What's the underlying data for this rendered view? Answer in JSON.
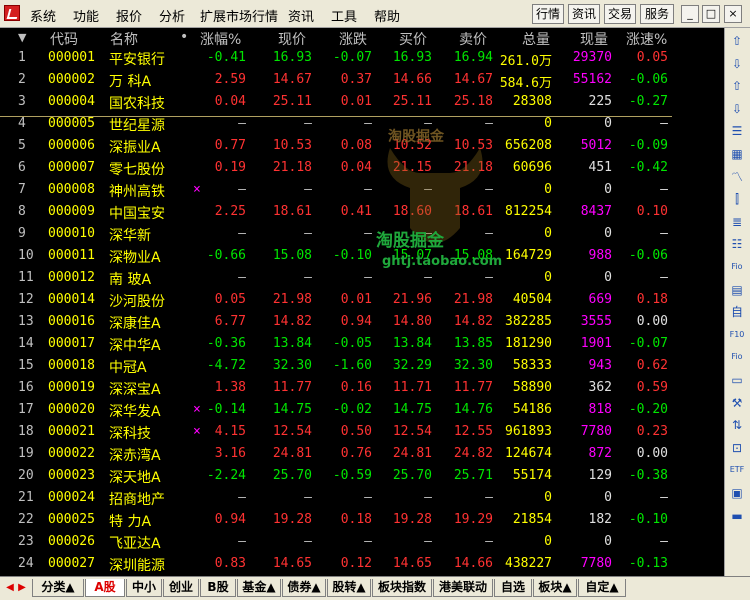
{
  "menubar": {
    "items": [
      "系统",
      "功能",
      "报价",
      "分析",
      "扩展市场行情",
      "资讯",
      "工具",
      "帮助"
    ],
    "right_buttons": [
      "行情",
      "资讯",
      "交易",
      "服务"
    ],
    "window_buttons": [
      "_",
      "□",
      "×"
    ]
  },
  "table": {
    "headers": {
      "sort": "▼",
      "code": "代码",
      "name": "名称",
      "dot": "•",
      "pct": "涨幅%",
      "price": "现价",
      "change": "涨跌",
      "bid": "买价",
      "ask": "卖价",
      "vol": "总量",
      "cur": "现量",
      "speed": "涨速%"
    },
    "rows": [
      {
        "n": "1",
        "code": "000001",
        "name": "平安银行",
        "mark": "",
        "pct": "-0.41",
        "price": "16.93",
        "chg": "-0.07",
        "bid": "16.93",
        "ask": "16.94",
        "vol": "261.0万",
        "cur": "29370",
        "spd": "0.05",
        "dir": "down",
        "curc": "m",
        "spdc": "r"
      },
      {
        "n": "2",
        "code": "000002",
        "name": "万 科A",
        "mark": "",
        "pct": "2.59",
        "price": "14.67",
        "chg": "0.37",
        "bid": "14.66",
        "ask": "14.67",
        "vol": "584.6万",
        "cur": "55162",
        "spd": "-0.06",
        "dir": "up",
        "curc": "m",
        "spdc": "g"
      },
      {
        "n": "3",
        "code": "000004",
        "name": "国农科技",
        "mark": "",
        "pct": "0.04",
        "price": "25.11",
        "chg": "0.01",
        "bid": "25.11",
        "ask": "25.18",
        "vol": "28308",
        "cur": "225",
        "spd": "-0.27",
        "dir": "up",
        "curc": "w",
        "spdc": "g"
      },
      {
        "n": "4",
        "code": "000005",
        "name": "世纪星源",
        "mark": "",
        "pct": "–",
        "price": "–",
        "chg": "–",
        "bid": "–",
        "ask": "–",
        "vol": "0",
        "cur": "0",
        "spd": "–",
        "dir": "flat",
        "curc": "w",
        "spdc": "w"
      },
      {
        "n": "5",
        "code": "000006",
        "name": "深振业A",
        "mark": "",
        "pct": "0.77",
        "price": "10.53",
        "chg": "0.08",
        "bid": "10.52",
        "ask": "10.53",
        "vol": "656208",
        "cur": "5012",
        "spd": "-0.09",
        "dir": "up",
        "curc": "m",
        "spdc": "g"
      },
      {
        "n": "6",
        "code": "000007",
        "name": "零七股份",
        "mark": "",
        "pct": "0.19",
        "price": "21.18",
        "chg": "0.04",
        "bid": "21.15",
        "ask": "21.18",
        "vol": "60696",
        "cur": "451",
        "spd": "-0.42",
        "dir": "up",
        "curc": "w",
        "spdc": "g"
      },
      {
        "n": "7",
        "code": "000008",
        "name": "神州高铁",
        "mark": "×",
        "pct": "–",
        "price": "–",
        "chg": "–",
        "bid": "–",
        "ask": "–",
        "vol": "0",
        "cur": "0",
        "spd": "–",
        "dir": "flat",
        "curc": "w",
        "spdc": "w"
      },
      {
        "n": "8",
        "code": "000009",
        "name": "中国宝安",
        "mark": "",
        "pct": "2.25",
        "price": "18.61",
        "chg": "0.41",
        "bid": "18.60",
        "ask": "18.61",
        "vol": "812254",
        "cur": "8437",
        "spd": "0.10",
        "dir": "up",
        "curc": "m",
        "spdc": "r"
      },
      {
        "n": "9",
        "code": "000010",
        "name": "深华新",
        "mark": "",
        "pct": "–",
        "price": "–",
        "chg": "–",
        "bid": "–",
        "ask": "–",
        "vol": "0",
        "cur": "0",
        "spd": "–",
        "dir": "flat",
        "curc": "w",
        "spdc": "w"
      },
      {
        "n": "10",
        "code": "000011",
        "name": "深物业A",
        "mark": "",
        "pct": "-0.66",
        "price": "15.08",
        "chg": "-0.10",
        "bid": "15.07",
        "ask": "15.08",
        "vol": "164729",
        "cur": "988",
        "spd": "-0.06",
        "dir": "down",
        "curc": "m",
        "spdc": "g"
      },
      {
        "n": "11",
        "code": "000012",
        "name": "南 玻A",
        "mark": "",
        "pct": "–",
        "price": "–",
        "chg": "–",
        "bid": "–",
        "ask": "–",
        "vol": "0",
        "cur": "0",
        "spd": "–",
        "dir": "flat",
        "curc": "w",
        "spdc": "w"
      },
      {
        "n": "12",
        "code": "000014",
        "name": "沙河股份",
        "mark": "",
        "pct": "0.05",
        "price": "21.98",
        "chg": "0.01",
        "bid": "21.96",
        "ask": "21.98",
        "vol": "40504",
        "cur": "669",
        "spd": "0.18",
        "dir": "up",
        "curc": "m",
        "spdc": "r"
      },
      {
        "n": "13",
        "code": "000016",
        "name": "深康佳A",
        "mark": "",
        "pct": "6.77",
        "price": "14.82",
        "chg": "0.94",
        "bid": "14.80",
        "ask": "14.82",
        "vol": "382285",
        "cur": "3555",
        "spd": "0.00",
        "dir": "up",
        "curc": "m",
        "spdc": "w"
      },
      {
        "n": "14",
        "code": "000017",
        "name": "深中华A",
        "mark": "",
        "pct": "-0.36",
        "price": "13.84",
        "chg": "-0.05",
        "bid": "13.84",
        "ask": "13.85",
        "vol": "181290",
        "cur": "1901",
        "spd": "-0.07",
        "dir": "down",
        "curc": "m",
        "spdc": "g"
      },
      {
        "n": "15",
        "code": "000018",
        "name": "中冠A",
        "mark": "",
        "pct": "-4.72",
        "price": "32.30",
        "chg": "-1.60",
        "bid": "32.29",
        "ask": "32.30",
        "vol": "58333",
        "cur": "943",
        "spd": "0.62",
        "dir": "down",
        "curc": "m",
        "spdc": "r"
      },
      {
        "n": "16",
        "code": "000019",
        "name": "深深宝A",
        "mark": "",
        "pct": "1.38",
        "price": "11.77",
        "chg": "0.16",
        "bid": "11.71",
        "ask": "11.77",
        "vol": "58890",
        "cur": "362",
        "spd": "0.59",
        "dir": "up",
        "curc": "w",
        "spdc": "r"
      },
      {
        "n": "17",
        "code": "000020",
        "name": "深华发A",
        "mark": "×",
        "pct": "-0.14",
        "price": "14.75",
        "chg": "-0.02",
        "bid": "14.75",
        "ask": "14.76",
        "vol": "54186",
        "cur": "818",
        "spd": "-0.20",
        "dir": "down",
        "curc": "m",
        "spdc": "g"
      },
      {
        "n": "18",
        "code": "000021",
        "name": "深科技",
        "mark": "×",
        "pct": "4.15",
        "price": "12.54",
        "chg": "0.50",
        "bid": "12.54",
        "ask": "12.55",
        "vol": "961893",
        "cur": "7780",
        "spd": "0.23",
        "dir": "up",
        "curc": "m",
        "spdc": "r"
      },
      {
        "n": "19",
        "code": "000022",
        "name": "深赤湾A",
        "mark": "",
        "pct": "3.16",
        "price": "24.81",
        "chg": "0.76",
        "bid": "24.81",
        "ask": "24.82",
        "vol": "124674",
        "cur": "872",
        "spd": "0.00",
        "dir": "up",
        "curc": "m",
        "spdc": "w"
      },
      {
        "n": "20",
        "code": "000023",
        "name": "深天地A",
        "mark": "",
        "pct": "-2.24",
        "price": "25.70",
        "chg": "-0.59",
        "bid": "25.70",
        "ask": "25.71",
        "vol": "55174",
        "cur": "129",
        "spd": "-0.38",
        "dir": "down",
        "curc": "w",
        "spdc": "g"
      },
      {
        "n": "21",
        "code": "000024",
        "name": "招商地产",
        "mark": "",
        "pct": "–",
        "price": "–",
        "chg": "–",
        "bid": "–",
        "ask": "–",
        "vol": "0",
        "cur": "0",
        "spd": "–",
        "dir": "flat",
        "curc": "w",
        "spdc": "w"
      },
      {
        "n": "22",
        "code": "000025",
        "name": "特 力A",
        "mark": "",
        "pct": "0.94",
        "price": "19.28",
        "chg": "0.18",
        "bid": "19.28",
        "ask": "19.29",
        "vol": "21854",
        "cur": "182",
        "spd": "-0.10",
        "dir": "up",
        "curc": "w",
        "spdc": "g"
      },
      {
        "n": "23",
        "code": "000026",
        "name": "飞亚达A",
        "mark": "",
        "pct": "–",
        "price": "–",
        "chg": "–",
        "bid": "–",
        "ask": "–",
        "vol": "0",
        "cur": "0",
        "spd": "–",
        "dir": "flat",
        "curc": "w",
        "spdc": "w"
      },
      {
        "n": "24",
        "code": "000027",
        "name": "深圳能源",
        "mark": "",
        "pct": "0.83",
        "price": "14.65",
        "chg": "0.12",
        "bid": "14.65",
        "ask": "14.66",
        "vol": "438227",
        "cur": "7780",
        "spd": "-0.13",
        "dir": "up",
        "curc": "m",
        "spdc": "g"
      }
    ]
  },
  "watermark": {
    "line1": "淘股掘金",
    "line2": "淘股掘金",
    "line3": "ghtj.taobao.com"
  },
  "toolbar_icons": [
    "up-arrow-icon",
    "down-arrow-icon",
    "up-blue-arrow-icon",
    "down-blue-arrow-icon",
    "report-icon",
    "table-icon",
    "line-chart-icon",
    "candle-icon",
    "list-icon",
    "doc-icon",
    "fio-icon",
    "grid-icon",
    "self-icon",
    "f10-icon",
    "fio2-icon",
    "folder-icon",
    "tool-icon",
    "sort-icon",
    "target-icon",
    "etf-icon",
    "doc2-icon",
    "minus-icon"
  ],
  "toolbar_glyphs": [
    "⇧",
    "⇩",
    "⇧",
    "⇩",
    "☰",
    "▦",
    "〽",
    "⫿",
    "≣",
    "☷",
    "Fio",
    "▤",
    "自",
    "F10",
    "Fio",
    "▭",
    "⚒",
    "⇅",
    "⊡",
    "ETF",
    "▣",
    "▬"
  ],
  "tabs": [
    "分类▲",
    "A股",
    "中小",
    "创业",
    "B股",
    "基金▲",
    "债券▲",
    "股转▲",
    "板块指数",
    "港美联动",
    "自选",
    "板块▲",
    "自定▲"
  ],
  "active_tab": "A股",
  "colors": {
    "up": "#ff3232",
    "down": "#00e600",
    "flat": "#c0c0c0",
    "yellow": "#ffff00",
    "magenta": "#ff00ff",
    "white": "#e0e0e0",
    "code": "#ffff00",
    "name": "#ffff00"
  }
}
